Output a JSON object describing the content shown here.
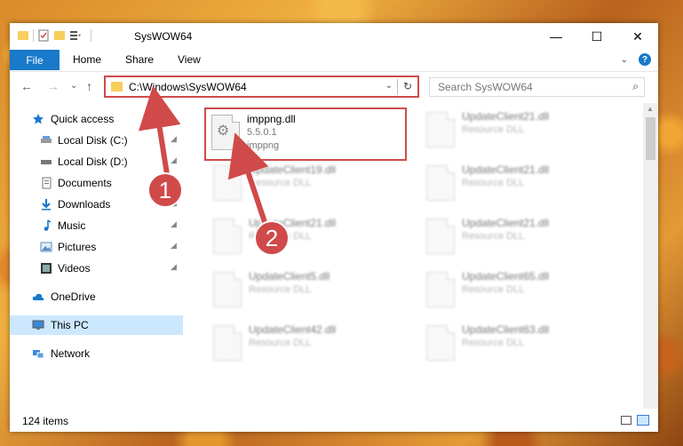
{
  "window": {
    "title": "SysWOW64",
    "minimize": "—",
    "maximize": "☐",
    "close": "✕"
  },
  "ribbon": {
    "file": "File",
    "tabs": [
      "Home",
      "Share",
      "View"
    ],
    "expand": "⌄",
    "help": "?"
  },
  "navbar": {
    "back": "←",
    "forward": "→",
    "recent": "⌄",
    "up": "↑",
    "address": "C:\\Windows\\SysWOW64",
    "address_dropdown": "⌄",
    "refresh": "↻",
    "search_placeholder": "Search SysWOW64",
    "search_icon": "⌕"
  },
  "sidebar": {
    "items": [
      {
        "label": "Quick access",
        "icon": "star-icon",
        "pinned": false
      },
      {
        "label": "Local Disk (C:)",
        "icon": "drive-icon",
        "pinned": true
      },
      {
        "label": "Local Disk (D:)",
        "icon": "drive-icon",
        "pinned": true
      },
      {
        "label": "Documents",
        "icon": "documents-icon",
        "pinned": true
      },
      {
        "label": "Downloads",
        "icon": "download-icon",
        "pinned": true
      },
      {
        "label": "Music",
        "icon": "music-icon",
        "pinned": true
      },
      {
        "label": "Pictures",
        "icon": "pictures-icon",
        "pinned": true
      },
      {
        "label": "Videos",
        "icon": "videos-icon",
        "pinned": true
      },
      {
        "label": "OneDrive",
        "icon": "cloud-icon",
        "pinned": false
      },
      {
        "label": "This PC",
        "icon": "computer-icon",
        "pinned": false,
        "selected": true
      },
      {
        "label": "Network",
        "icon": "network-icon",
        "pinned": false
      }
    ],
    "pin_glyph": "📌"
  },
  "files": {
    "highlighted": {
      "name": "imppng.dll",
      "version": "5.5.0.1",
      "description": "imppng"
    },
    "left_column": [
      {
        "name": "UpdateClient19.dll",
        "type": "Resource DLL"
      },
      {
        "name": "UpdateClient21.dll",
        "type": "Resource DLL"
      },
      {
        "name": "UpdateClient5.dll",
        "type": "Resource DLL"
      },
      {
        "name": "UpdateClient42.dll",
        "type": "Resource DLL"
      }
    ],
    "right_column": [
      {
        "name": "UpdateClient21.dll",
        "type": "Resource DLL"
      },
      {
        "name": "UpdateClient21.dll",
        "type": "Resource DLL"
      },
      {
        "name": "UpdateClient21.dll",
        "type": "Resource DLL"
      },
      {
        "name": "UpdateClient65.dll",
        "type": "Resource DLL"
      },
      {
        "name": "UpdateClient63.dll",
        "type": "Resource DLL"
      }
    ]
  },
  "status": {
    "item_count": "124 items"
  },
  "callouts": [
    "1",
    "2"
  ],
  "colors": {
    "accent": "#1979ca",
    "highlight_red": "#d04a4a",
    "selected_bg": "#cce8ff"
  }
}
